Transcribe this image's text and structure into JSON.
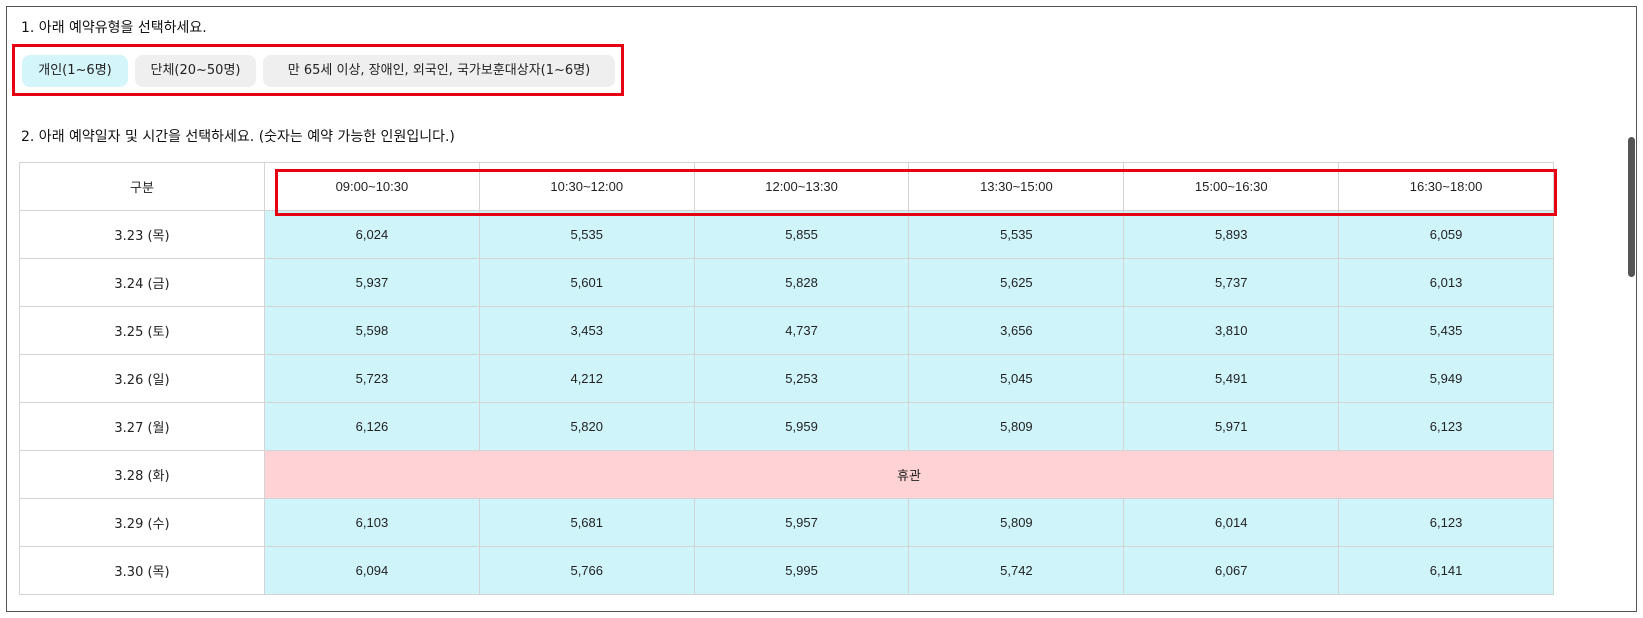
{
  "step1": {
    "title": "1. 아래 예약유형을 선택하세요."
  },
  "types": [
    {
      "label": "개인(1~6명)",
      "active": true
    },
    {
      "label": "단체(20~50명)",
      "active": false
    },
    {
      "label": "만 65세 이상, 장애인, 외국인, 국가보훈대상자(1~6명)",
      "active": false
    }
  ],
  "step2": {
    "title": "2. 아래 예약일자 및 시간을 선택하세요. (숫자는 예약 가능한 인원입니다.)"
  },
  "table": {
    "header_label": "구분",
    "time_slots": [
      "09:00~10:30",
      "10:30~12:00",
      "12:00~13:30",
      "13:30~15:00",
      "15:00~16:30",
      "16:30~18:00"
    ],
    "rows": [
      {
        "date": "3.23 (목)",
        "values": [
          "6,024",
          "5,535",
          "5,855",
          "5,535",
          "5,893",
          "6,059"
        ]
      },
      {
        "date": "3.24 (금)",
        "values": [
          "5,937",
          "5,601",
          "5,828",
          "5,625",
          "5,737",
          "6,013"
        ]
      },
      {
        "date": "3.25 (토)",
        "values": [
          "5,598",
          "3,453",
          "4,737",
          "3,656",
          "3,810",
          "5,435"
        ]
      },
      {
        "date": "3.26 (일)",
        "values": [
          "5,723",
          "4,212",
          "5,253",
          "5,045",
          "5,491",
          "5,949"
        ]
      },
      {
        "date": "3.27 (월)",
        "values": [
          "6,126",
          "5,820",
          "5,959",
          "5,809",
          "5,971",
          "6,123"
        ]
      },
      {
        "date": "3.28 (화)",
        "closed": "휴관"
      },
      {
        "date": "3.29 (수)",
        "values": [
          "6,103",
          "5,681",
          "5,957",
          "5,809",
          "6,014",
          "6,123"
        ]
      },
      {
        "date": "3.30 (목)",
        "values": [
          "6,094",
          "5,766",
          "5,995",
          "5,742",
          "6,067",
          "6,141"
        ]
      }
    ]
  }
}
